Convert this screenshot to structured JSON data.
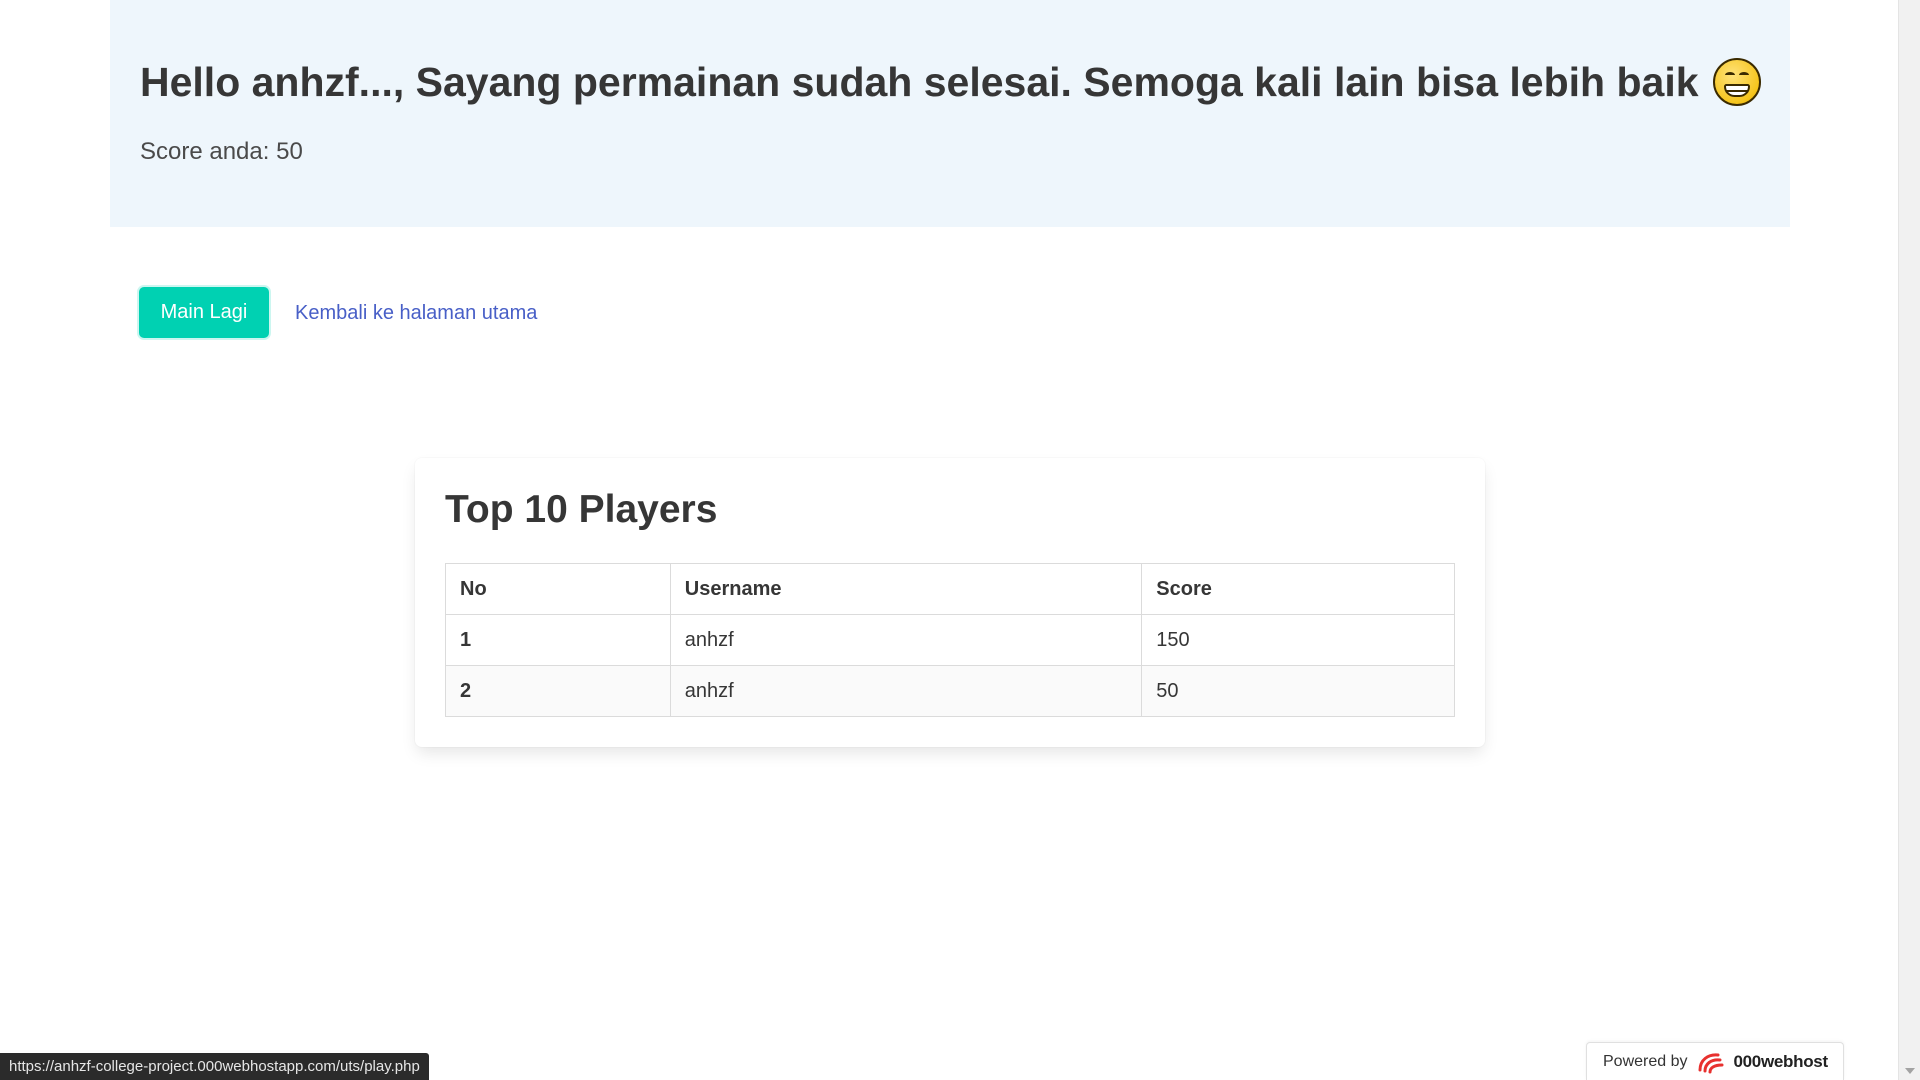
{
  "hero": {
    "title": "Hello anhzf..., Sayang permainan sudah selesai. Semoga kali lain bisa lebih baik",
    "emoji_icon": "grinning-face-icon",
    "subtitle": "Score anda: 50"
  },
  "actions": {
    "play_again_label": "Main Lagi",
    "home_link_label": "Kembali ke halaman utama"
  },
  "leaderboard": {
    "title": "Top 10 Players",
    "columns": [
      "No",
      "Username",
      "Score"
    ],
    "rows": [
      {
        "no": "1",
        "username": "anhzf",
        "score": "150"
      },
      {
        "no": "2",
        "username": "anhzf",
        "score": "50"
      }
    ]
  },
  "status_bar": {
    "url": "https://anhzf-college-project.000webhostapp.com/uts/play.php"
  },
  "badge": {
    "powered_by": "Powered by",
    "brand": "000webhost",
    "brand_icon": "000webhost-logo-icon"
  },
  "colors": {
    "primary": "#00d1b2",
    "link": "#485fc7",
    "hero_bg": "#eef6fc"
  }
}
